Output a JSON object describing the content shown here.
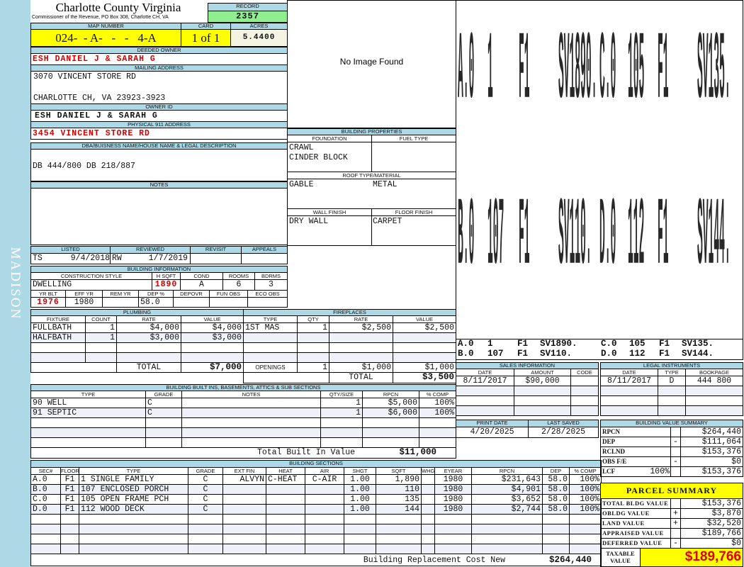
{
  "sidebar": {
    "district": "MADISON"
  },
  "header": {
    "title": "Charlotte County Virginia",
    "subtitle": "Commissioner of the Revenue, PO Box 308, Charlotte CH, VA",
    "record_label": "RECORD",
    "record": "2357"
  },
  "parcel": {
    "map_label": "MAP NUMBER",
    "card_label": "CARD",
    "acres_label": "ACRES",
    "map_number": "024-  - A-   -   -   4-A",
    "card": "1 of 1",
    "acres": "5.4400"
  },
  "owner": {
    "deeded_label": "DEEDED OWNER",
    "deeded": "ESH DANIEL J & SARAH G",
    "mailing_label": "MAILING ADDRESS",
    "mailing_line1": "3070 VINCENT STORE RD",
    "mailing_line2": "CHARLOTTE CH, VA 23923-3923",
    "owner_id_label": "OWNER ID",
    "owner_id": "ESH DANIEL J & SARAH G",
    "physical_label": "PHYSICAL 911 ADDRESS",
    "physical": "3454 VINCENT STORE RD"
  },
  "dba": {
    "label": "DBA/BUISNESS NAME/HOUSE NAME & LEGAL DESCRIPTION",
    "value": "DB 444/800 DB 218/887"
  },
  "notes": {
    "label": "NOTES"
  },
  "image": {
    "placeholder": "No Image Found"
  },
  "building_properties": {
    "title": "BUILDING PROPERTIES",
    "foundation_label": "FOUNDATION",
    "fuel_label": "FUEL TYPE",
    "foundation": [
      "CRAWL",
      "CINDER BLOCK"
    ],
    "roof_label": "ROOF TYPE/MATERIAL",
    "roof_type": "GABLE",
    "roof_material": "METAL",
    "wall_label": "WALL FINISH",
    "floor_label": "FLOOR FINISH",
    "wall": "DRY WALL",
    "floor": "CARPET"
  },
  "sketch": {
    "labels": [
      [
        "A.0",
        "1",
        "F1",
        "SV1890.",
        "C.0",
        "105",
        "F1",
        "SV135."
      ],
      [
        "B.0",
        "107",
        "F1",
        "SV110.",
        "D.0",
        "112",
        "F1",
        "SV144."
      ]
    ]
  },
  "review": {
    "headers": [
      "LISTED",
      "REVIEWED",
      "REVISIT",
      "APPEALS"
    ],
    "listed_by": "TS",
    "listed_date": "9/4/2018",
    "reviewed_by": "RW",
    "reviewed_date": "1/7/2019"
  },
  "building_info": {
    "title": "BUILDING INFORMATION",
    "headers1": [
      "CONSTRUCTION STYLE",
      "H SQFT",
      "COND",
      "ROOMS",
      "BDRMS"
    ],
    "values1": [
      "DWELLING",
      "1890",
      "A",
      "6",
      "3"
    ],
    "headers2": [
      "YR BLT",
      "EFF YR",
      "REM YR",
      "DEP %",
      "DEPOVR",
      "FUN OBS",
      "ECO OBS"
    ],
    "values2": [
      "1976",
      "1980",
      "",
      "58.0",
      "",
      "",
      ""
    ]
  },
  "plumbing": {
    "title": "PLUMBING",
    "headers": [
      "FIXTURE",
      "COUNT",
      "RATE",
      "VALUE"
    ],
    "rows": [
      [
        "FULLBATH",
        "1",
        "$4,000",
        "$4,000"
      ],
      [
        "HALFBATH",
        "1",
        "$3,000",
        "$3,000"
      ]
    ],
    "total_label": "TOTAL",
    "total": "$7,000"
  },
  "fireplaces": {
    "title": "FIREPLACES",
    "headers": [
      "TYPE",
      "QTY",
      "RATE",
      "VALUE"
    ],
    "rows": [
      [
        "1ST MAS",
        "1",
        "$2,500",
        "$2,500"
      ]
    ],
    "openings": [
      "OPENINGS",
      "1",
      "$1,000",
      "$1,000"
    ],
    "total_label": "TOTAL",
    "total": "$3,500"
  },
  "built_ins": {
    "title": "BUILDING BUILT INS, BASEMENTS, ATTICS & SUB SECTIONS",
    "headers": [
      "TYPE",
      "GRADE",
      "NOTES",
      "QTY/SIZE",
      "RPCN",
      "% COMP"
    ],
    "rows": [
      [
        "90 WELL",
        "C",
        "",
        "1",
        "$5,000",
        "100%"
      ],
      [
        "91 SEPTIC",
        "C",
        "",
        "1",
        "$6,000",
        "100%"
      ]
    ],
    "total_label": "Total Built In Value",
    "total": "$11,000"
  },
  "sections": {
    "title": "BUILDING SECTIONS",
    "headers": [
      "SEC#",
      "FLOOR",
      "TYPE",
      "GRADE",
      "EXT FIN",
      "HEAT",
      "AIR",
      "SHGT",
      "SQFT",
      "WHGT",
      "EYEAR",
      "RPCN",
      "DEP",
      "% COMP"
    ],
    "rows": [
      [
        "A.0",
        "F1",
        "1 SINGLE FAMILY",
        "C",
        "ALVYN",
        "C-HEAT",
        "C-AIR",
        "1.00",
        "1,890",
        "",
        "1980",
        "$231,643",
        "58.0",
        "100%"
      ],
      [
        "B.0",
        "F1",
        "107 ENCLOSED PORCH",
        "C",
        "",
        "",
        "",
        "1.00",
        "110",
        "",
        "1980",
        "$4,901",
        "58.0",
        "100%"
      ],
      [
        "C.0",
        "F1",
        "105 OPEN FRAME PCH",
        "C",
        "",
        "",
        "",
        "1.00",
        "135",
        "",
        "1980",
        "$3,652",
        "58.0",
        "100%"
      ],
      [
        "D.0",
        "F1",
        "112 WOOD DECK",
        "C",
        "",
        "",
        "",
        "1.00",
        "144",
        "",
        "1980",
        "$2,744",
        "58.0",
        "100%"
      ]
    ],
    "total_label": "Building Replacement Cost New",
    "total": "$264,440"
  },
  "sales": {
    "title": "SALES INFORMATION",
    "headers": [
      "DATE",
      "AMOUNT",
      "CODE"
    ],
    "rows": [
      [
        "8/11/2017",
        "$90,000",
        ""
      ]
    ]
  },
  "legal": {
    "title": "LEGAL INSTRUMENTS",
    "headers": [
      "DATE",
      "TYPE",
      "BOOKPAGE"
    ],
    "rows": [
      [
        "8/11/2017",
        "D",
        "444 800"
      ]
    ]
  },
  "dates": {
    "headers": [
      "PRINT DATE",
      "LAST SAVED"
    ],
    "values": [
      "4/20/2025",
      "2/28/2025"
    ]
  },
  "value_summary": {
    "title": "BUILDING VALUE SUMMARY",
    "rows": [
      [
        "RPCN",
        "",
        "$264,440"
      ],
      [
        "DEP",
        "-",
        "$111,064"
      ],
      [
        "RCLND",
        "",
        "$153,376"
      ],
      [
        "OBS F/E",
        "-",
        "$0"
      ],
      [
        "LCF",
        "",
        "$153,376"
      ]
    ],
    "lcf_pct": "100%"
  },
  "parcel_summary": {
    "title": "PARCEL SUMMARY",
    "rows": [
      [
        "TOTAL BLDG VALUE",
        "",
        "$153,376"
      ],
      [
        "OBLDG VALUE",
        "+",
        "$3,870"
      ],
      [
        "LAND VALUE",
        "+",
        "$32,520"
      ],
      [
        "APPRAISED VALUE",
        "",
        "$189,766"
      ],
      [
        "DEFERRED VALUE",
        "-",
        "$0"
      ]
    ],
    "taxable_label": "TAXABLE\nVALUE",
    "taxable": "$189,766"
  },
  "colors": {
    "header": "#add8e6",
    "highlight": "#ffff00",
    "record": "#90ee90",
    "emphasis": "#d40000"
  }
}
